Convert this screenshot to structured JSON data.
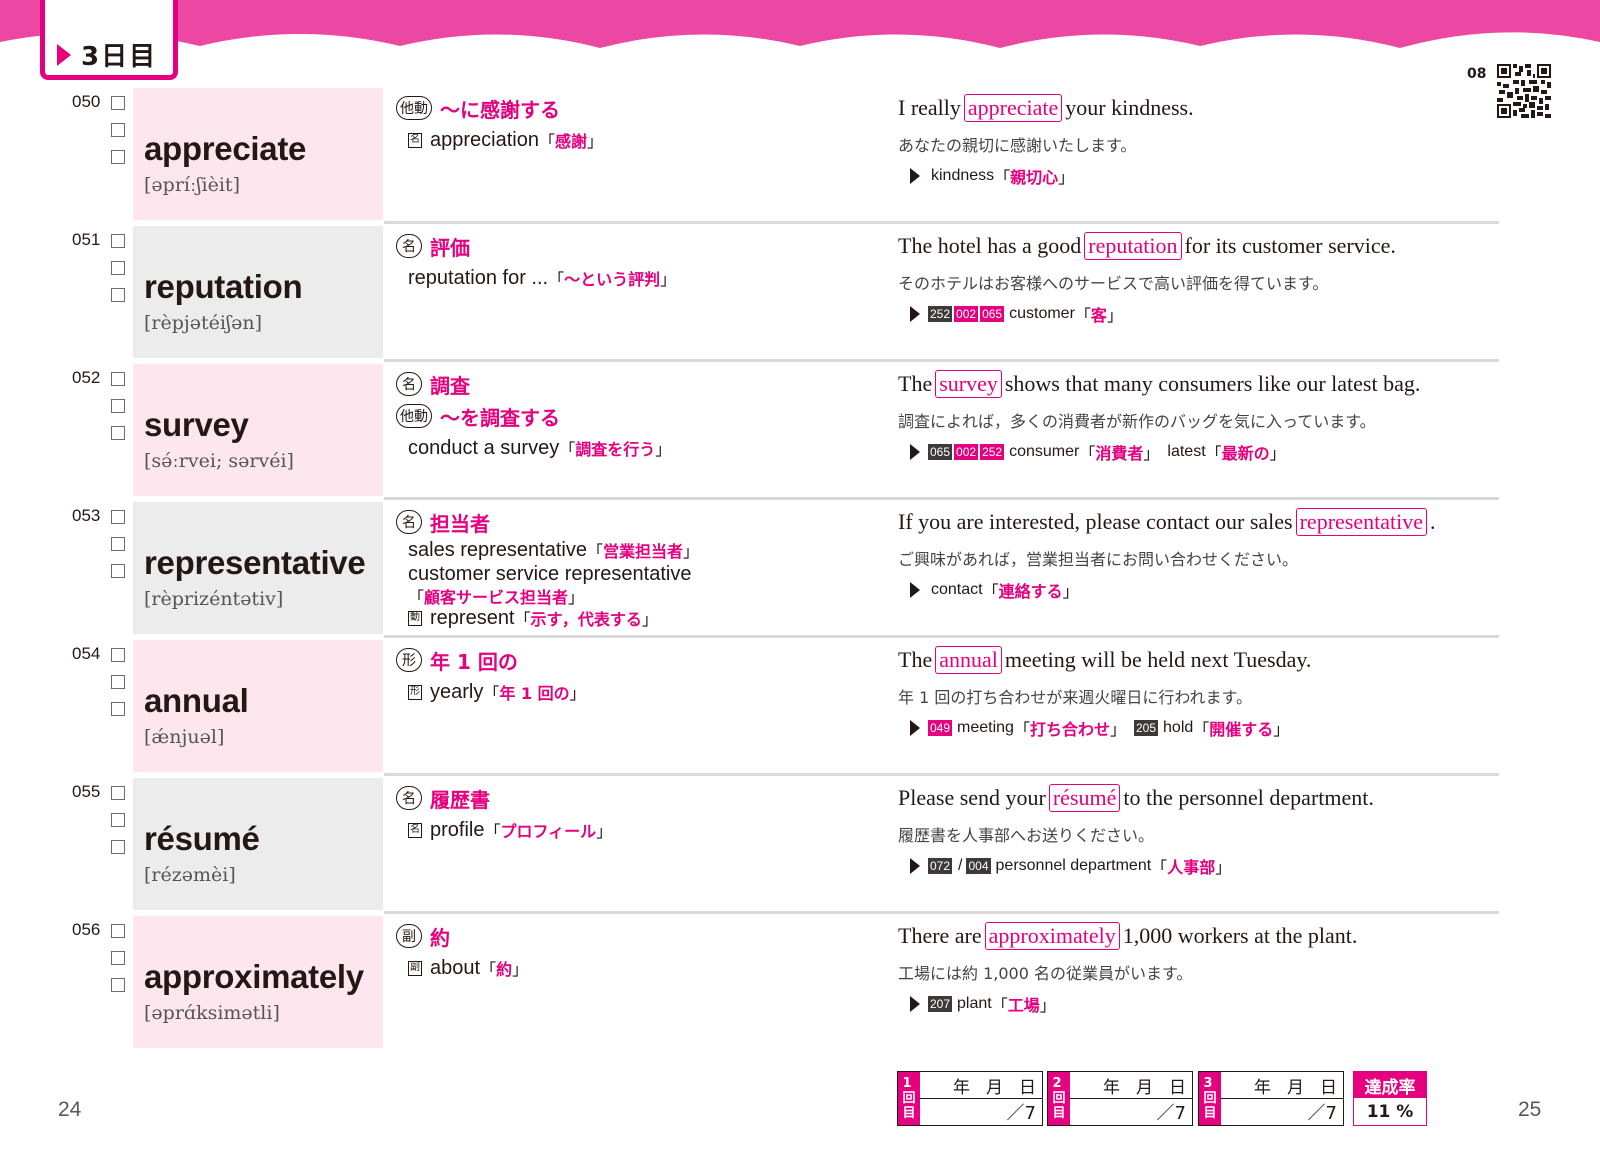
{
  "header": {
    "day_label": "3日目",
    "track": "08"
  },
  "pages": {
    "left": "24",
    "right": "25"
  },
  "entries": [
    {
      "num": "050",
      "word": "appreciate",
      "pron": "[əpríːʃièit]",
      "defs": [
        {
          "pos": "他動",
          "jp": "～に感謝する"
        },
        {
          "icon": "名",
          "en": "appreciation",
          "jp": "感謝"
        }
      ],
      "sentence": {
        "before": "I really",
        "key": "appreciate",
        "after": "your kindness."
      },
      "translation": "あなたの親切に感謝いたします。",
      "refs": [
        {
          "badges": [],
          "word": "kindness",
          "jp": "親切心"
        }
      ]
    },
    {
      "num": "051",
      "word": "reputation",
      "pron": "[rèpjətéiʃən]",
      "defs": [
        {
          "pos": "名",
          "jp": "評価"
        },
        {
          "en": "reputation for ...",
          "jp": "～という評判"
        }
      ],
      "sentence": {
        "before": "The hotel has a good",
        "key": "reputation",
        "after": "for its customer service."
      },
      "translation": "そのホテルはお客様へのサービスで高い評価を得ています。",
      "refs": [
        {
          "badges": [
            "252",
            "002",
            "065"
          ],
          "word": "customer",
          "jp": "客"
        }
      ]
    },
    {
      "num": "052",
      "word": "survey",
      "pron": "[sə́ːrvei; sərvéi]",
      "defs": [
        {
          "pos": "名",
          "jp": "調査"
        },
        {
          "pos": "他動",
          "jp": "～を調査する"
        },
        {
          "en": "conduct a survey",
          "jp": "調査を行う"
        }
      ],
      "sentence": {
        "before": "The",
        "key": "survey",
        "after": "shows that many consumers like our latest bag."
      },
      "translation": "調査によれば，多くの消費者が新作のバッグを気に入っています。",
      "refs": [
        {
          "badges": [
            "065",
            "002",
            "252"
          ],
          "word": "consumer",
          "jp": "消費者"
        },
        {
          "badges": [],
          "word": "latest",
          "jp": "最新の"
        }
      ]
    },
    {
      "num": "053",
      "word": "representative",
      "pron": "[rèprizéntətiv]",
      "defs": [
        {
          "pos": "名",
          "jp": "担当者"
        },
        {
          "en": "sales representative",
          "jp": "営業担当者"
        },
        {
          "en": "customer service representative",
          "jp": ""
        },
        {
          "en": "",
          "jp": "顧客サービス担当者"
        },
        {
          "icon": "動",
          "en": "represent",
          "jp": "示す，代表する"
        }
      ],
      "sentence": {
        "before": "If you are interested, please contact our sales",
        "key": "representative",
        "after": "."
      },
      "translation": "ご興味があれば，営業担当者にお問い合わせください。",
      "refs": [
        {
          "badges": [],
          "word": "contact",
          "jp": "連絡する"
        }
      ]
    },
    {
      "num": "054",
      "word": "annual",
      "pron": "[ǽnjuəl]",
      "defs": [
        {
          "pos": "形",
          "jp": "年 1 回の"
        },
        {
          "icon": "形",
          "en": "yearly",
          "jp": "年 1 回の"
        }
      ],
      "sentence": {
        "before": "The",
        "key": "annual",
        "after": "meeting will be held next Tuesday."
      },
      "translation": "年 1 回の打ち合わせが来週火曜日に行われます。",
      "refs": [
        {
          "badges": [
            "049"
          ],
          "word": "meeting",
          "jp": "打ち合わせ"
        },
        {
          "badges": [
            "205"
          ],
          "word": "hold",
          "jp": "開催する"
        }
      ]
    },
    {
      "num": "055",
      "word": "résumé",
      "pron": "[rézəmèi]",
      "defs": [
        {
          "pos": "名",
          "jp": "履歴書"
        },
        {
          "icon": "名",
          "en": "profile",
          "jp": "プロフィール"
        }
      ],
      "sentence": {
        "before": "Please send your",
        "key": "résumé",
        "after": "to the personnel department."
      },
      "translation": "履歴書を人事部へお送りください。",
      "refs": [
        {
          "badges": [
            "072",
            "004"
          ],
          "word": "personnel department",
          "jp": "人事部"
        }
      ]
    },
    {
      "num": "056",
      "word": "approximately",
      "pron": "[əprɑ́ksimətli]",
      "defs": [
        {
          "pos": "副",
          "jp": "約"
        },
        {
          "icon": "副",
          "en": "about",
          "jp": "約"
        }
      ],
      "sentence": {
        "before": "There are",
        "key": "approximately",
        "after": "1,000 workers at the plant."
      },
      "translation": "工場には約 1,000 名の従業員がいます。",
      "refs": [
        {
          "badges": [
            "207"
          ],
          "word": "plant",
          "jp": "工場"
        }
      ]
    }
  ],
  "records": [
    {
      "round": "1回目",
      "date": [
        "年",
        "月",
        "日"
      ],
      "score": "／7"
    },
    {
      "round": "2回目",
      "date": [
        "年",
        "月",
        "日"
      ],
      "score": "／7"
    },
    {
      "round": "3回目",
      "date": [
        "年",
        "月",
        "日"
      ],
      "score": "／7"
    }
  ],
  "achievement": {
    "label": "達成率",
    "value": "11 %"
  },
  "colors": {
    "accent": "#e4007f",
    "pink_bg": "#fde6ee",
    "gray_bg": "#ececec"
  }
}
